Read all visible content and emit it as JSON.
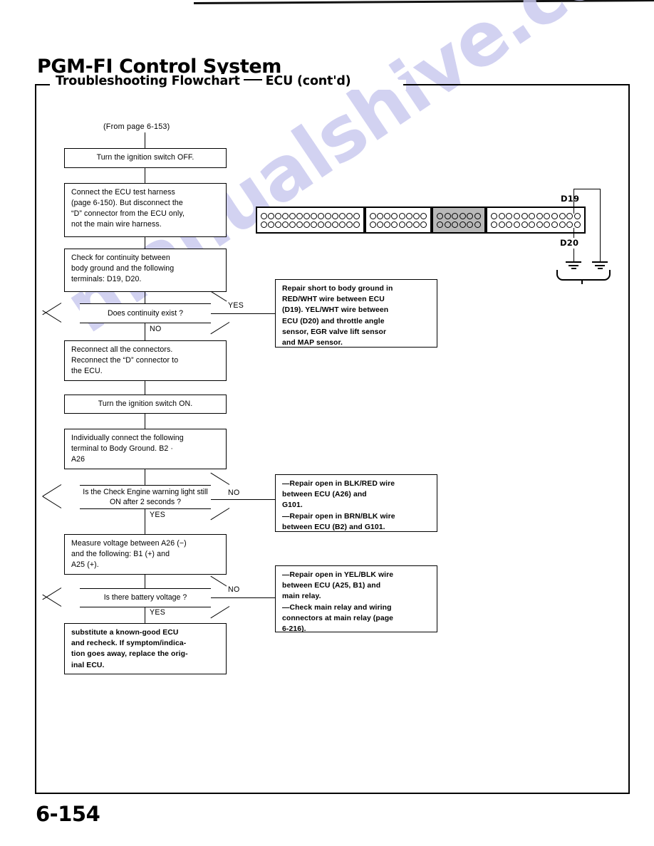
{
  "document": {
    "title": "PGM-FI Control System",
    "section_prefix": "Troubleshooting Flowchart",
    "section_suffix": "ECU (cont'd)",
    "page_number": "6-154",
    "watermark": "manualshive.com"
  },
  "flow": {
    "from_page": "(From page 6-153)",
    "steps": [
      {
        "id": "step-ignition-off",
        "text": "Turn the ignition switch OFF."
      },
      {
        "id": "step-connect-harness",
        "lines": [
          "Connect the ECU test harness",
          "(page 6-150). But disconnect the",
          "“D” connector from the ECU only,",
          "not the main wire harness."
        ]
      },
      {
        "id": "step-check-continuity",
        "lines": [
          "Check for continuity between",
          "body ground and the following",
          "terminals: D19, D20."
        ]
      },
      {
        "id": "step-reconnect",
        "lines": [
          "Reconnect all the connectors.",
          "Reconnect the “D” connector to",
          "the ECU."
        ]
      },
      {
        "id": "step-ignition-on",
        "text": "Turn the ignition switch ON."
      },
      {
        "id": "step-individually-connect",
        "lines": [
          "Individually connect the following",
          "terminal to Body Ground. B2 ·",
          "A26"
        ]
      },
      {
        "id": "step-measure-voltage",
        "lines": [
          "Measure voltage between A26 (−)",
          "and the following: B1 (+) and",
          "A25 (+)."
        ]
      },
      {
        "id": "step-substitute-ecu",
        "lines": [
          "substitute a known-good ECU",
          "and recheck. If symptom/indica-",
          "tion goes away, replace the orig-",
          "inal ECU."
        ]
      }
    ],
    "decisions": [
      {
        "id": "decision-continuity",
        "text": "Does continuity exist ?",
        "branch_side": "YES",
        "branch_down": "NO"
      },
      {
        "id": "decision-check-engine",
        "lines": [
          "Is the Check Engine warning light",
          "still ON after 2 seconds ?"
        ],
        "branch_side": "NO",
        "branch_down": "YES"
      },
      {
        "id": "decision-battery-voltage",
        "text": "Is there battery voltage ?",
        "branch_side": "NO",
        "branch_down": "YES"
      }
    ],
    "repairs": [
      {
        "id": "repair-short-body-ground",
        "lines": [
          "Repair short to body ground in",
          "RED/WHT wire between ECU",
          "(D19). YEL/WHT wire between",
          "ECU (D20) and throttle angle",
          "sensor, EGR valve lift sensor",
          "and MAP sensor."
        ]
      },
      {
        "id": "repair-open-blk-red",
        "lines": [
          "—Repair open in BLK/RED wire",
          "between ECU (A26) and",
          "G101.",
          "—Repair open in BRN/BLK wire",
          "between ECU (B2) and G101."
        ]
      },
      {
        "id": "repair-open-yel-blk",
        "lines": [
          "—Repair open in YEL/BLK wire",
          "between ECU (A25, B1) and",
          "main relay.",
          "—Check main relay and wiring",
          "connectors at main relay (page",
          "6-216)."
        ]
      }
    ]
  },
  "connector_diagram": {
    "blocks": [
      {
        "id": "connector-block-a",
        "pins_per_row": 14,
        "shaded": false
      },
      {
        "id": "connector-block-b",
        "pins_per_row": 8,
        "shaded": false
      },
      {
        "id": "connector-block-c",
        "pins_per_row": 6,
        "shaded": true
      },
      {
        "id": "connector-block-d",
        "pins_per_row": 12,
        "shaded": false
      }
    ],
    "labels": {
      "top_terminal": "D19",
      "bottom_terminal": "D20"
    }
  }
}
